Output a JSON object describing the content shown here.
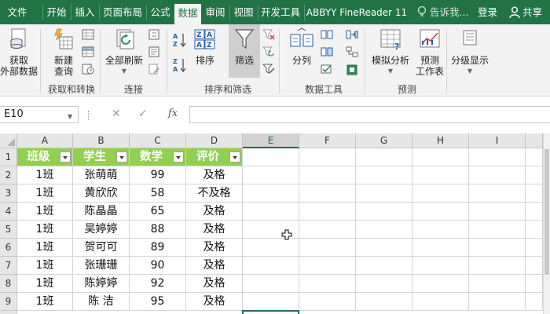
{
  "tabs": [
    {
      "label": "文件",
      "active": false
    },
    {
      "label": "开始",
      "active": false
    },
    {
      "label": "插入",
      "active": false
    },
    {
      "label": "页面布局",
      "active": false
    },
    {
      "label": "公式",
      "active": false
    },
    {
      "label": "数据",
      "active": true
    },
    {
      "label": "审阅",
      "active": false
    },
    {
      "label": "视图",
      "active": false
    },
    {
      "label": "开发工具",
      "active": false
    },
    {
      "label": "ABBYY FineReader 11",
      "active": false
    }
  ],
  "tell_me": "告诉我...",
  "login": "登录",
  "share": "共享",
  "ribbon": {
    "get_external_line1": "获取",
    "get_external_line2": "外部数据",
    "new_query_line1": "新建",
    "new_query_line2": "查询",
    "refresh_all": "全部刷新",
    "sort": "排序",
    "filter": "筛选",
    "split": "分列",
    "whatif": "模拟分析",
    "forecast_line1": "预测",
    "forecast_line2": "工作表",
    "outline": "分级显示",
    "groups": {
      "get_transform": "获取和转换",
      "connections": "连接",
      "sort_filter": "排序和筛选",
      "data_tools": "数据工具",
      "forecast": "预测"
    }
  },
  "formula_bar": {
    "name_box": "E10",
    "fx": "fx",
    "formula": ""
  },
  "columns": [
    "A",
    "B",
    "C",
    "D",
    "E",
    "F",
    "G",
    "H",
    "I"
  ],
  "selected_column": "E",
  "row_numbers": [
    "1",
    "2",
    "3",
    "4",
    "5",
    "6",
    "7",
    "8",
    "9"
  ],
  "table": {
    "headers": [
      "班级",
      "学生",
      "数学",
      "评价"
    ],
    "rows": [
      [
        "1班",
        "张萌萌",
        "99",
        "及格"
      ],
      [
        "1班",
        "黄欣欣",
        "58",
        "不及格"
      ],
      [
        "1班",
        "陈晶晶",
        "65",
        "及格"
      ],
      [
        "1班",
        "吴婷婷",
        "88",
        "及格"
      ],
      [
        "1班",
        "贺可可",
        "89",
        "及格"
      ],
      [
        "1班",
        "张珊珊",
        "90",
        "及格"
      ],
      [
        "1班",
        "陈婷婷",
        "92",
        "及格"
      ],
      [
        "1班",
        "陈  洁",
        "95",
        "及格"
      ]
    ]
  },
  "colors": {
    "excel_green": "#217346",
    "header_fill": "#92d050",
    "ribbon_bg": "#f3f3f3"
  }
}
